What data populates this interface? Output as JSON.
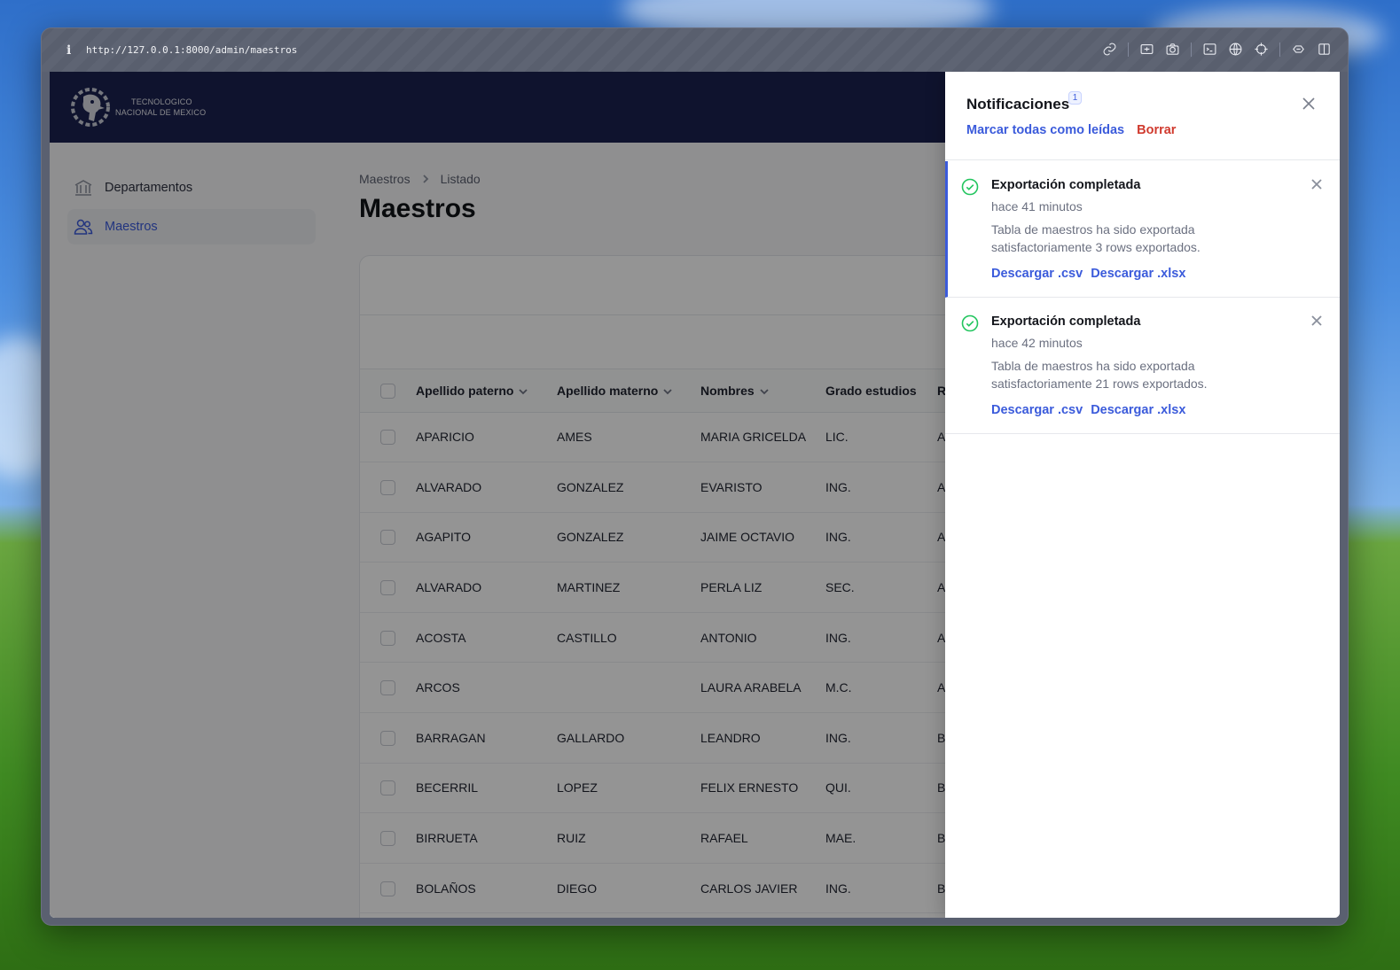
{
  "browser": {
    "url": "http://127.0.0.1:8000/admin/maestros",
    "tools": [
      "link-icon",
      "screenshot-area-icon",
      "camera-icon",
      "terminal-icon",
      "globe-icon",
      "crosshair-icon",
      "extensions-icon",
      "split-view-icon"
    ]
  },
  "brand": {
    "line1": "TECNOLOGICO",
    "line2": "NACIONAL DE MEXICO"
  },
  "sidebar": {
    "items": [
      {
        "label": "Departamentos",
        "icon": "building-columns-icon",
        "active": false
      },
      {
        "label": "Maestros",
        "icon": "users-icon",
        "active": true
      }
    ]
  },
  "breadcrumb": [
    "Maestros",
    "Listado"
  ],
  "page_title": "Maestros",
  "table": {
    "columns": [
      "Apellido paterno",
      "Apellido materno",
      "Nombres",
      "Grado estudios",
      "R"
    ],
    "rows": [
      [
        "APARICIO",
        "AMES",
        "MARIA GRICELDA",
        "LIC.",
        "A"
      ],
      [
        "ALVARADO",
        "GONZALEZ",
        "EVARISTO",
        "ING.",
        "A"
      ],
      [
        "AGAPITO",
        "GONZALEZ",
        "JAIME OCTAVIO",
        "ING.",
        "A"
      ],
      [
        "ALVARADO",
        "MARTINEZ",
        "PERLA LIZ",
        "SEC.",
        "A"
      ],
      [
        "ACOSTA",
        "CASTILLO",
        "ANTONIO",
        "ING.",
        "A"
      ],
      [
        "ARCOS",
        "",
        "LAURA ARABELA",
        "M.C.",
        "A"
      ],
      [
        "BARRAGAN",
        "GALLARDO",
        "LEANDRO",
        "ING.",
        "B"
      ],
      [
        "BECERRIL",
        "LOPEZ",
        "FELIX ERNESTO",
        "QUI.",
        "B"
      ],
      [
        "BIRRUETA",
        "RUIZ",
        "RAFAEL",
        "MAE.",
        "B"
      ],
      [
        "BOLAÑOS",
        "DIEGO",
        "CARLOS JAVIER",
        "ING.",
        "B"
      ]
    ]
  },
  "notifications": {
    "title": "Notificaciones",
    "badge": "1",
    "mark_all_read": "Marcar todas como leídas",
    "clear": "Borrar",
    "items": [
      {
        "title": "Exportación completada",
        "time": "hace 41 minutos",
        "body": "Tabla de maestros ha sido exportada satisfactoriamente 3 rows exportados.",
        "link_csv": "Descargar .csv",
        "link_xlsx": "Descargar .xlsx",
        "unread": true
      },
      {
        "title": "Exportación completada",
        "time": "hace 42 minutos",
        "body": "Tabla de maestros ha sido exportada satisfactoriamente 21 rows exportados.",
        "link_csv": "Descargar .csv",
        "link_xlsx": "Descargar .xlsx",
        "unread": false
      }
    ]
  },
  "colors": {
    "topbar": "#1a2250",
    "accent": "#3b5bdb",
    "danger": "#d03a2e",
    "success": "#22c55e"
  }
}
